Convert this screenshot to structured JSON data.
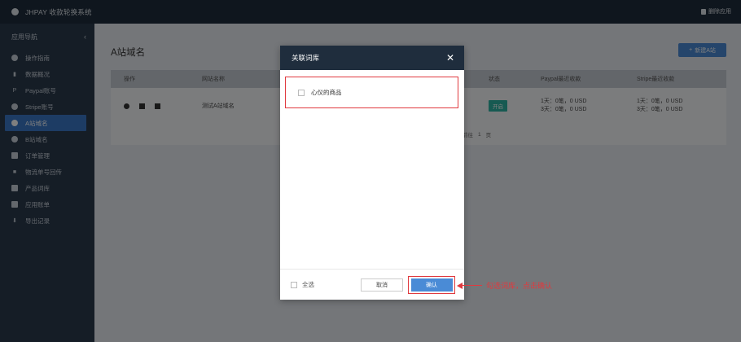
{
  "topbar": {
    "title": "JHPAY 收款轮换系统",
    "delete_app": "删除应用"
  },
  "sidebar": {
    "heading": "应用导航",
    "collapse": "‹",
    "items": [
      {
        "label": "操作指南",
        "icon": "gauge-icon"
      },
      {
        "label": "数据概况",
        "icon": "bar-chart-icon"
      },
      {
        "label": "Paypal账号",
        "icon": "paypal-icon"
      },
      {
        "label": "Stripe账号",
        "icon": "stripe-icon"
      },
      {
        "label": "A站域名",
        "icon": "globe-icon"
      },
      {
        "label": "B站域名",
        "icon": "globe-icon"
      },
      {
        "label": "订单管理",
        "icon": "list-icon"
      },
      {
        "label": "物流单号回传",
        "icon": "truck-icon"
      },
      {
        "label": "产品词库",
        "icon": "book-icon"
      },
      {
        "label": "应用账单",
        "icon": "bill-icon"
      },
      {
        "label": "导出记录",
        "icon": "download-icon"
      }
    ]
  },
  "main": {
    "page_title": "A站域名",
    "add_button": "新建A站",
    "add_button_icon": "+",
    "table": {
      "headers": [
        "操作",
        "网站名称",
        "状态",
        "Paypal最近收款",
        "Stripe最近收款"
      ],
      "rows": [
        {
          "name": "测试A站域名",
          "status": "开启",
          "paypal_1": "1天：0笔，0 USD",
          "paypal_3": "3天：0笔，0 USD",
          "stripe_1": "1天：0笔，0 USD",
          "stripe_3": "3天：0笔，0 USD"
        }
      ],
      "pager": {
        "prefix": "前往",
        "page": "1",
        "suffix": "页"
      }
    }
  },
  "modal": {
    "title": "关联词库",
    "close": "✕",
    "library_item": "心仪的商品",
    "select_all": "全选",
    "cancel": "取消",
    "confirm": "确认"
  },
  "annotation": {
    "text": "勾选词库，点击确认",
    "color": "#e0393e"
  },
  "colors": {
    "topbar": "#1f2d3d",
    "sidebar": "#2a3a4c",
    "accent": "#4a8bd6",
    "status_on": "#2fb5a5",
    "highlight": "#e0393e"
  }
}
